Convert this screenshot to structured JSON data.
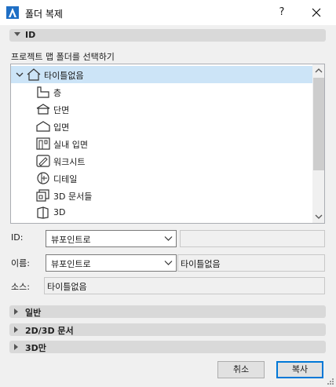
{
  "window": {
    "title": "폴더 복제",
    "help_label": "?"
  },
  "id_panel": {
    "label": "ID",
    "caption": "프로젝트 맵 폴더를 선택하기",
    "tree": [
      {
        "label": "타이틀없음",
        "icon": "house-icon"
      },
      {
        "label": "층",
        "icon": "floor-plan-icon"
      },
      {
        "label": "단면",
        "icon": "section-icon"
      },
      {
        "label": "입면",
        "icon": "elevation-icon"
      },
      {
        "label": "실내 입면",
        "icon": "interior-elevation-icon"
      },
      {
        "label": "워크시트",
        "icon": "worksheet-icon"
      },
      {
        "label": "디테일",
        "icon": "detail-icon"
      },
      {
        "label": "3D 문서들",
        "icon": "3d-documents-icon"
      },
      {
        "label": "3D",
        "icon": "3d-icon"
      }
    ],
    "id_label": "ID:",
    "id_combo_value": "뷰포인트로",
    "id_text_value": "",
    "name_label": "이름:",
    "name_combo_value": "뷰포인트로",
    "name_text_value": "타이틀없음",
    "source_label": "소스:",
    "source_value": "타이틀없음"
  },
  "collapsed_panels": [
    {
      "label": "일반"
    },
    {
      "label": "2D/3D 문서"
    },
    {
      "label": "3D만"
    }
  ],
  "buttons": {
    "cancel": "취소",
    "copy": "복사"
  },
  "colors": {
    "selection": "#cce4f7",
    "default_button_border": "#0078d7",
    "panel_bar": "#d9d9d9"
  }
}
